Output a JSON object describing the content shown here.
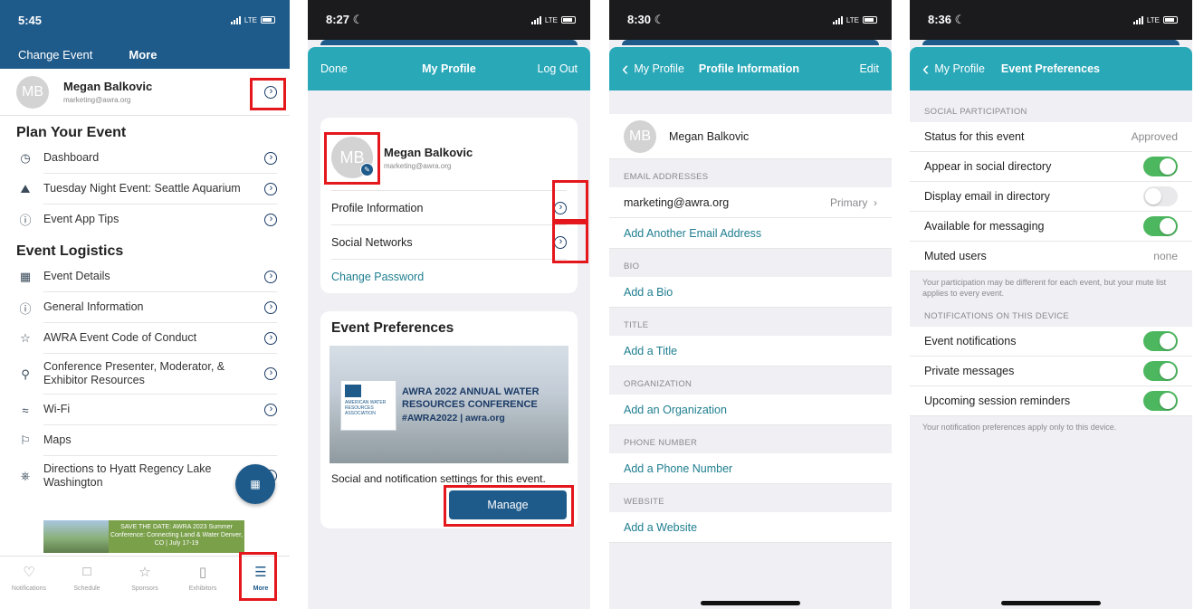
{
  "panel1": {
    "status": {
      "time": "5:45",
      "network": "LTE"
    },
    "header": {
      "change_event": "Change Event",
      "more": "More"
    },
    "user": {
      "initials": "MB",
      "name": "Megan Balkovic",
      "email": "marketing@awra.org"
    },
    "sections": [
      {
        "title": "Plan Your Event",
        "items": [
          {
            "label": "Dashboard",
            "icon": "dashboard-icon"
          },
          {
            "label": "Tuesday Night Event: Seattle Aquarium",
            "icon": "car-icon"
          },
          {
            "label": "Event App Tips",
            "icon": "info-icon"
          }
        ]
      },
      {
        "title": "Event Logistics",
        "items": [
          {
            "label": "Event Details",
            "icon": "calendar-icon"
          },
          {
            "label": "General Information",
            "icon": "info-icon"
          },
          {
            "label": "AWRA Event Code of Conduct",
            "icon": "star-icon"
          },
          {
            "label": "Conference Presenter, Moderator, & Exhibitor Resources",
            "icon": "location-pin-icon"
          },
          {
            "label": "Wi-Fi",
            "icon": "wifi-icon"
          },
          {
            "label": "Maps",
            "icon": "map-icon"
          },
          {
            "label": "Directions to Hyatt Regency Lake Washington",
            "icon": "directions-icon"
          }
        ]
      }
    ],
    "banner": {
      "text": "SAVE THE DATE: AWRA 2023 Summer Conference: Connecting Land & Water Denver, CO | July 17-19"
    },
    "tabs": [
      {
        "label": "Notifications",
        "icon": "bell-icon"
      },
      {
        "label": "Schedule",
        "icon": "calendar-icon"
      },
      {
        "label": "Sponsors",
        "icon": "star-icon"
      },
      {
        "label": "Exhibitors",
        "icon": "document-icon"
      },
      {
        "label": "More",
        "icon": "hamburger-icon"
      }
    ]
  },
  "panel2": {
    "status": {
      "time": "8:27",
      "network": "LTE"
    },
    "nav": {
      "left": "Done",
      "title": "My Profile",
      "right": "Log Out"
    },
    "user": {
      "initials": "MB",
      "name": "Megan Balkovic",
      "email": "marketing@awra.org"
    },
    "rows": {
      "profile_info": "Profile Information",
      "social": "Social Networks",
      "change_password": "Change Password"
    },
    "prefs": {
      "title": "Event Preferences",
      "image_title": "AWRA 2022 ANNUAL WATER RESOURCES CONFERENCE",
      "image_tag": "#AWRA2022 | awra.org",
      "logo_text": "AMERICAN WATER RESOURCES ASSOCIATION",
      "desc": "Social and notification settings for this event.",
      "button": "Manage"
    }
  },
  "panel3": {
    "status": {
      "time": "8:30",
      "network": "LTE"
    },
    "nav": {
      "back": "My Profile",
      "title": "Profile Information",
      "right": "Edit"
    },
    "user": {
      "initials": "MB",
      "name": "Megan Balkovic"
    },
    "email_header": "EMAIL ADDRESSES",
    "email": "marketing@awra.org",
    "email_detail": "Primary",
    "add_email": "Add Another Email Address",
    "bio_header": "BIO",
    "add_bio": "Add a Bio",
    "title_header": "TITLE",
    "add_title": "Add a Title",
    "org_header": "ORGANIZATION",
    "add_org": "Add an Organization",
    "phone_header": "PHONE NUMBER",
    "add_phone": "Add a Phone Number",
    "web_header": "WEBSITE",
    "add_web": "Add a Website"
  },
  "panel4": {
    "status": {
      "time": "8:36",
      "network": "LTE"
    },
    "nav": {
      "back": "My Profile",
      "title": "Event Preferences"
    },
    "social_header": "SOCIAL PARTICIPATION",
    "status_label": "Status for this event",
    "status_value": "Approved",
    "appear_label": "Appear in social directory",
    "appear_on": true,
    "display_email_label": "Display email in directory",
    "display_email_on": false,
    "messaging_label": "Available for messaging",
    "messaging_on": true,
    "muted_label": "Muted users",
    "muted_value": "none",
    "social_note": "Your participation may be different for each event, but your mute list applies to every event.",
    "notif_header": "NOTIFICATIONS ON THIS DEVICE",
    "event_notif_label": "Event notifications",
    "event_notif_on": true,
    "private_label": "Private messages",
    "private_on": true,
    "reminders_label": "Upcoming session reminders",
    "reminders_on": true,
    "notif_note": "Your notification preferences apply only to this device."
  },
  "colors": {
    "header_blue": "#1e5a8a",
    "teal": "#29a8b8",
    "toggle_on": "#4cb75e",
    "highlight_red": "#e4171c",
    "link_teal": "#1e7e8f"
  }
}
